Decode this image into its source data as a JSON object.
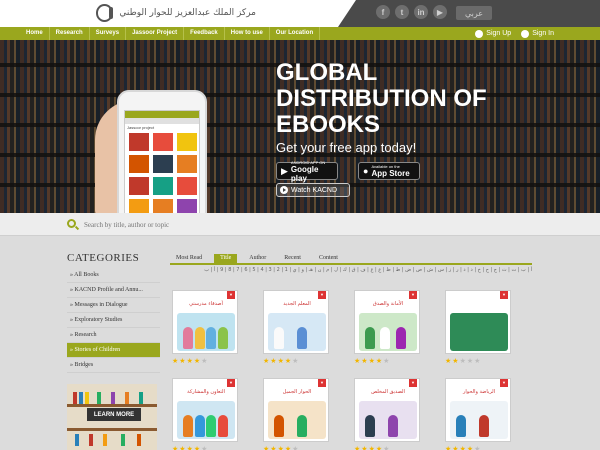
{
  "header": {
    "logo_text": "مركز الملك عبدالعزيز للحوار الوطني",
    "social": [
      {
        "icon": "facebook-icon",
        "glyph": "f"
      },
      {
        "icon": "twitter-icon",
        "glyph": "t"
      },
      {
        "icon": "linkedin-icon",
        "glyph": "in"
      },
      {
        "icon": "youtube-icon",
        "glyph": "▶"
      }
    ],
    "lang_button": "عربي"
  },
  "nav": {
    "items": [
      "Home",
      "Research",
      "Surveys",
      "Jassoor Project",
      "Feedback",
      "How to use",
      "Our Location"
    ],
    "signup": "Sign Up",
    "signin": "Sign In"
  },
  "hero": {
    "title": "GLOBAL DISTRIBUTION OF EBOOKS",
    "subtitle": "Get your free app today!",
    "google_small": "ANDROID APP ON",
    "google_big": "Google play",
    "apple_small": "Available on the",
    "apple_big": "App Store",
    "watch": "Watch KACND",
    "phone_title": "Jassoor project"
  },
  "search": {
    "placeholder": "Search by title, author or topic"
  },
  "sidebar": {
    "title": "CATEGORIES",
    "items": [
      "» All Books",
      "» KACND Profile and Annu...",
      "» Messages in Dialogue",
      "» Exploratory Studies",
      "» Research",
      "» Stories of Children",
      "» Bridges"
    ],
    "active_index": 5,
    "learn_more": "LEARN MORE"
  },
  "tabs": [
    "Most Read",
    "Title",
    "Author",
    "Recent",
    "Content"
  ],
  "active_tab": 1,
  "alphabet": "أ | ب | ت | ث | ج | ح | خ | د | ذ | ر | ز | س | ش | ص | ض | ط | ظ | ع | غ | ف | ق | ك | ل | م | ن | هـ | و | ي | 1 | 2 | 3 | 4 | 5 | 6 | 7 | 8 | 9 | أ | ب",
  "books": [
    {
      "cover_title": "أصدقاء مدرستي",
      "rating": 4,
      "scene": "#bfe3f0",
      "figs": [
        "#e27b9b",
        "#f0c040",
        "#62b0e0",
        "#8bc34a"
      ]
    },
    {
      "cover_title": "المعلم الجديد",
      "rating": 4,
      "scene": "#d6e8f5",
      "figs": [
        "#fafafa",
        "#5b8fd4"
      ]
    },
    {
      "cover_title": "الأمانة والصدق",
      "rating": 4,
      "scene": "#cde8c8",
      "figs": [
        "#3c9a4f",
        "#ffffff",
        "#9c27b0"
      ]
    },
    {
      "cover_title": "",
      "rating": 2,
      "scene": "#2e8b57",
      "figs": []
    },
    {
      "cover_title": "التعاون والمشاركة",
      "rating": 4,
      "scene": "#cfe6f2",
      "figs": [
        "#e67e22",
        "#3498db",
        "#2ecc71",
        "#e74c3c"
      ]
    },
    {
      "cover_title": "الحوار الجميل",
      "rating": 4,
      "scene": "#f5e3c8",
      "figs": [
        "#d35400",
        "#27ae60"
      ]
    },
    {
      "cover_title": "الصديق المخلص",
      "rating": 4,
      "scene": "#e8e0f0",
      "figs": [
        "#2c3e50",
        "#8e44ad"
      ]
    },
    {
      "cover_title": "الرياضة والحوار",
      "rating": 4,
      "scene": "#eef3f7",
      "figs": [
        "#2980b9",
        "#c0392b"
      ]
    }
  ],
  "colors": {
    "accent": "#9aa71e",
    "star_on": "#f2b600",
    "star_off": "#bdbdbd"
  }
}
